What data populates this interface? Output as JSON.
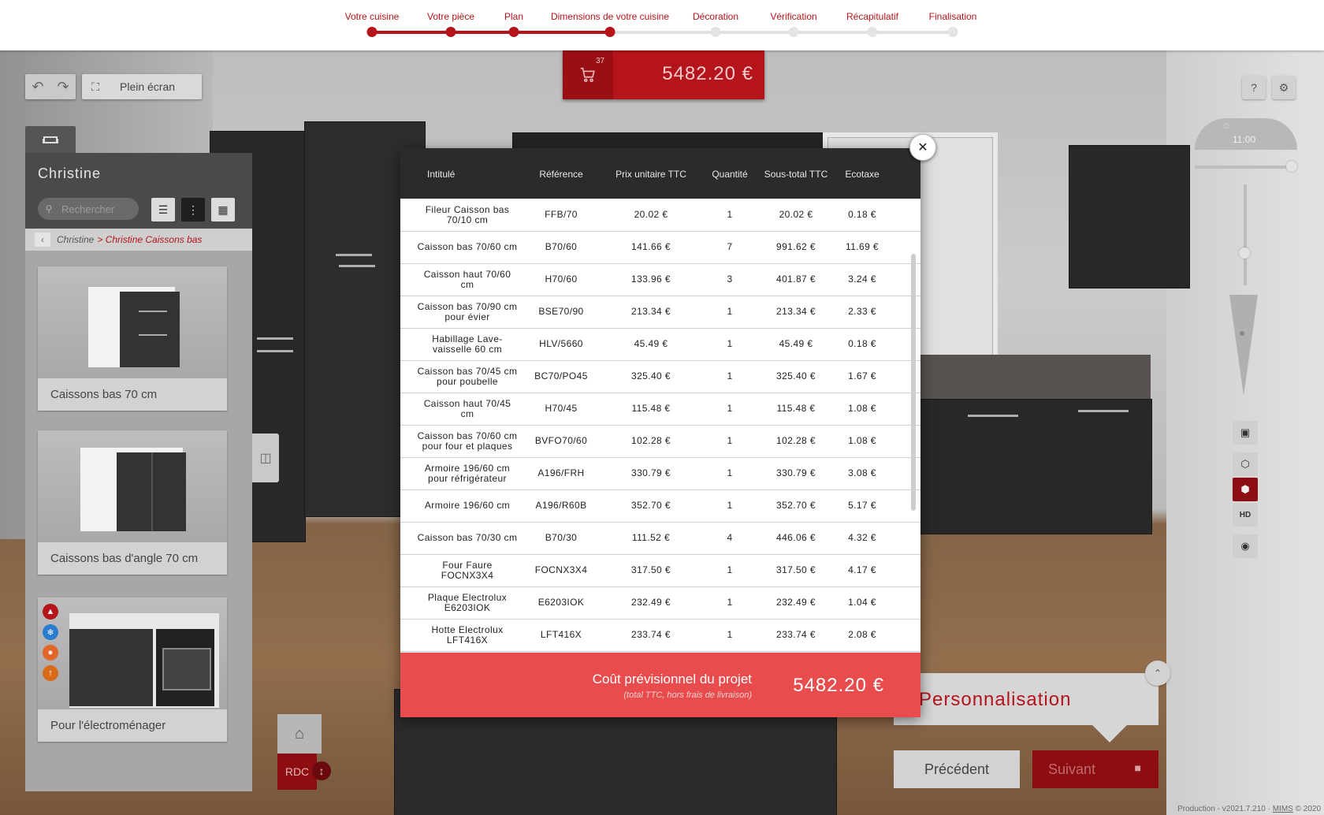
{
  "stepper": {
    "steps": [
      {
        "label": "Votre cuisine",
        "done": true
      },
      {
        "label": "Votre pièce",
        "done": true
      },
      {
        "label": "Plan",
        "done": true
      },
      {
        "label": "Dimensions de votre cuisine",
        "done": true
      },
      {
        "label": "Décoration",
        "done": false
      },
      {
        "label": "Vérification",
        "done": false
      },
      {
        "label": "Récapitulatif",
        "done": false
      },
      {
        "label": "Finalisation",
        "done": false
      }
    ]
  },
  "toolbar": {
    "fullscreen_label": "Plein écran",
    "help_label": "?"
  },
  "cart": {
    "count": "37",
    "total": "5482.20 €"
  },
  "clock": {
    "time": "11:00"
  },
  "left_panel": {
    "title": "Christine",
    "search_placeholder": "Rechercher",
    "breadcrumb": {
      "root": "Christine",
      "current": "> Christine Caissons bas"
    },
    "cards": [
      {
        "label": "Caissons bas 70 cm"
      },
      {
        "label": "Caissons bas d'angle 70 cm"
      },
      {
        "label": "Pour l'électroménager"
      }
    ]
  },
  "level": {
    "label": "RDC"
  },
  "modal": {
    "headers": [
      "Intitulé",
      "Référence",
      "Prix unitaire TTC",
      "Quantité",
      "Sous-total TTC",
      "Ecotaxe"
    ],
    "rows": [
      {
        "name": "Fileur Caisson bas 70/10 cm",
        "ref": "FFB/70",
        "unit": "20.02 €",
        "qty": "1",
        "subtotal": "20.02 €",
        "eco": "0.18 €"
      },
      {
        "name": "Caisson bas 70/60 cm",
        "ref": "B70/60",
        "unit": "141.66 €",
        "qty": "7",
        "subtotal": "991.62 €",
        "eco": "11.69 €"
      },
      {
        "name": "Caisson haut 70/60 cm",
        "ref": "H70/60",
        "unit": "133.96 €",
        "qty": "3",
        "subtotal": "401.87 €",
        "eco": "3.24 €"
      },
      {
        "name": "Caisson bas 70/90 cm pour évier",
        "ref": "BSE70/90",
        "unit": "213.34 €",
        "qty": "1",
        "subtotal": "213.34 €",
        "eco": "2.33 €"
      },
      {
        "name": "Habillage Lave-vaisselle 60 cm",
        "ref": "HLV/5660",
        "unit": "45.49 €",
        "qty": "1",
        "subtotal": "45.49 €",
        "eco": "0.18 €"
      },
      {
        "name": "Caisson bas 70/45 cm pour poubelle",
        "ref": "BC70/PO45",
        "unit": "325.40 €",
        "qty": "1",
        "subtotal": "325.40 €",
        "eco": "1.67 €"
      },
      {
        "name": "Caisson haut 70/45 cm",
        "ref": "H70/45",
        "unit": "115.48 €",
        "qty": "1",
        "subtotal": "115.48 €",
        "eco": "1.08 €"
      },
      {
        "name": "Caisson bas 70/60 cm pour four et plaques",
        "ref": "BVFO70/60",
        "unit": "102.28 €",
        "qty": "1",
        "subtotal": "102.28 €",
        "eco": "1.08 €"
      },
      {
        "name": "Armoire 196/60 cm pour réfrigérateur",
        "ref": "A196/FRH",
        "unit": "330.79 €",
        "qty": "1",
        "subtotal": "330.79 €",
        "eco": "3.08 €"
      },
      {
        "name": "Armoire 196/60 cm",
        "ref": "A196/R60B",
        "unit": "352.70 €",
        "qty": "1",
        "subtotal": "352.70 €",
        "eco": "5.17 €"
      },
      {
        "name": "Caisson bas 70/30 cm",
        "ref": "B70/30",
        "unit": "111.52 €",
        "qty": "4",
        "subtotal": "446.06 €",
        "eco": "4.32 €"
      },
      {
        "name": "Four Faure FOCNX3X4",
        "ref": "FOCNX3X4",
        "unit": "317.50 €",
        "qty": "1",
        "subtotal": "317.50 €",
        "eco": "4.17 €"
      },
      {
        "name": "Plaque Electrolux E6203IOK",
        "ref": "E6203IOK",
        "unit": "232.49 €",
        "qty": "1",
        "subtotal": "232.49 €",
        "eco": "1.04 €"
      },
      {
        "name": "Hotte Electrolux LFT416X",
        "ref": "LFT416X",
        "unit": "233.74 €",
        "qty": "1",
        "subtotal": "233.74 €",
        "eco": "2.08 €"
      }
    ],
    "footer": {
      "label": "Coût prévisionnel du projet",
      "sublabel": "(total TTC, hors frais de livraison)",
      "total": "5482.20 €"
    }
  },
  "personnalisation": {
    "label": "Personnalisation"
  },
  "nav": {
    "prev_label": "Précédent",
    "next_label": "Suivant"
  },
  "version": {
    "text": "Production - v2021.7.210 · ",
    "link": "MIMS",
    "suffix": " © 2020"
  }
}
